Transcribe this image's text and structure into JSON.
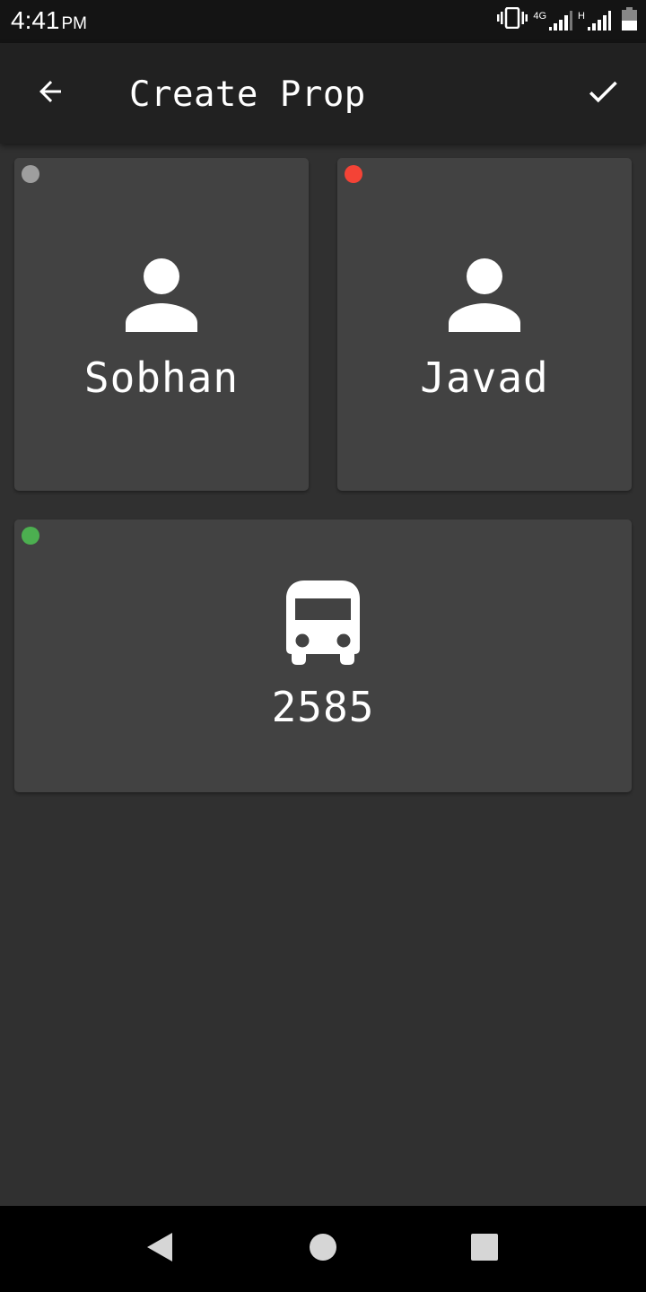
{
  "status_bar": {
    "time": "4:41",
    "ampm": "PM",
    "network_label_1": "4G",
    "network_label_2": "H",
    "icons": [
      "vibrate-icon",
      "signal-4g-icon",
      "signal-h-icon",
      "battery-icon"
    ]
  },
  "app_bar": {
    "title": "Create Prop",
    "back_icon": "arrow-back-icon",
    "confirm_icon": "check-icon"
  },
  "cards": [
    {
      "label": "Sobhan",
      "icon": "person-icon",
      "status_color": "#9e9e9e"
    },
    {
      "label": "Javad",
      "icon": "person-icon",
      "status_color": "#f44336"
    },
    {
      "label": "2585",
      "icon": "bus-icon",
      "status_color": "#4caf50"
    }
  ],
  "nav_bar": {
    "icons": [
      "nav-back-icon",
      "nav-home-icon",
      "nav-recents-icon"
    ]
  },
  "colors": {
    "background": "#303030",
    "app_bar": "#212121",
    "card": "#424242"
  }
}
